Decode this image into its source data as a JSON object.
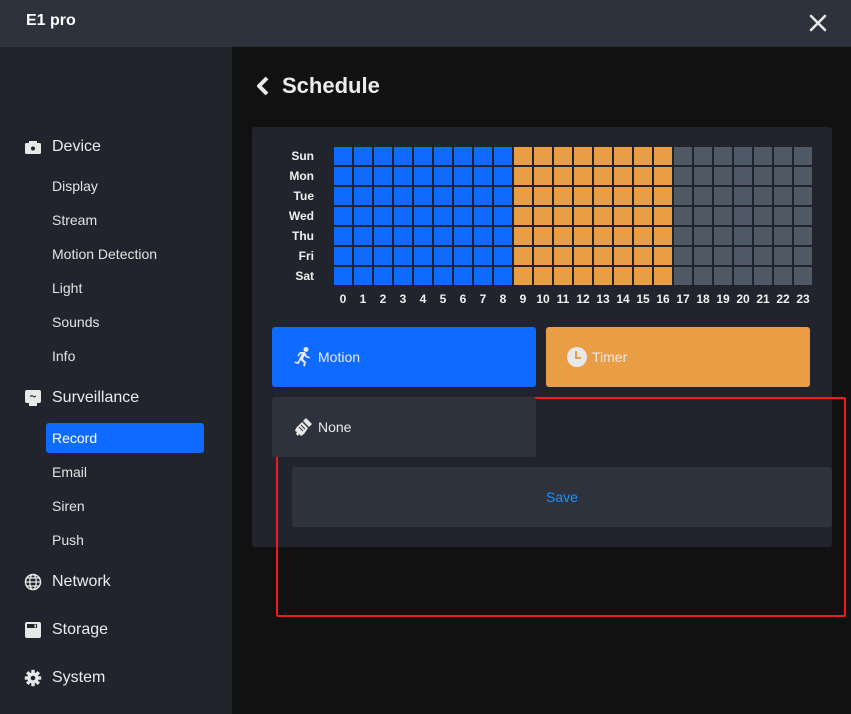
{
  "window": {
    "title": "E1 pro",
    "close_icon": "close-icon"
  },
  "sidebar": {
    "sections": [
      {
        "label": "Device",
        "icon": "camera-icon",
        "items": [
          "Display",
          "Stream",
          "Motion Detection",
          "Light",
          "Sounds",
          "Info"
        ]
      },
      {
        "label": "Surveillance",
        "icon": "monitor-icon",
        "items": [
          "Record",
          "Email",
          "Siren",
          "Push"
        ],
        "active_item": "Record"
      },
      {
        "label": "Network",
        "icon": "globe-icon",
        "items": []
      },
      {
        "label": "Storage",
        "icon": "save-disk-icon",
        "items": []
      },
      {
        "label": "System",
        "icon": "gear-icon",
        "items": []
      }
    ]
  },
  "page": {
    "title": "Schedule",
    "back_icon": "chevron-left-icon"
  },
  "schedule": {
    "days": [
      "Sun",
      "Mon",
      "Tue",
      "Wed",
      "Thu",
      "Fri",
      "Sat"
    ],
    "hours": [
      "0",
      "1",
      "2",
      "3",
      "4",
      "5",
      "6",
      "7",
      "8",
      "9",
      "10",
      "11",
      "12",
      "13",
      "14",
      "15",
      "16",
      "17",
      "18",
      "19",
      "20",
      "21",
      "22",
      "23"
    ],
    "hour_modes": [
      "motion",
      "motion",
      "motion",
      "motion",
      "motion",
      "motion",
      "motion",
      "motion",
      "motion",
      "timer",
      "timer",
      "timer",
      "timer",
      "timer",
      "timer",
      "timer",
      "timer",
      "none",
      "none",
      "none",
      "none",
      "none",
      "none",
      "none"
    ],
    "mode_colors": {
      "motion": "#0f6bff",
      "timer": "#e99d44",
      "none": "#505a66"
    }
  },
  "modes": {
    "motion": {
      "label": "Motion",
      "icon": "running-person-icon",
      "color": "#0f6bff"
    },
    "timer": {
      "label": "Timer",
      "icon": "clock-icon",
      "color": "#e99d44"
    },
    "none": {
      "label": "None",
      "icon": "brush-icon",
      "color": "#2d323c"
    }
  },
  "actions": {
    "save_label": "Save",
    "save_color": "#1e90ff"
  }
}
